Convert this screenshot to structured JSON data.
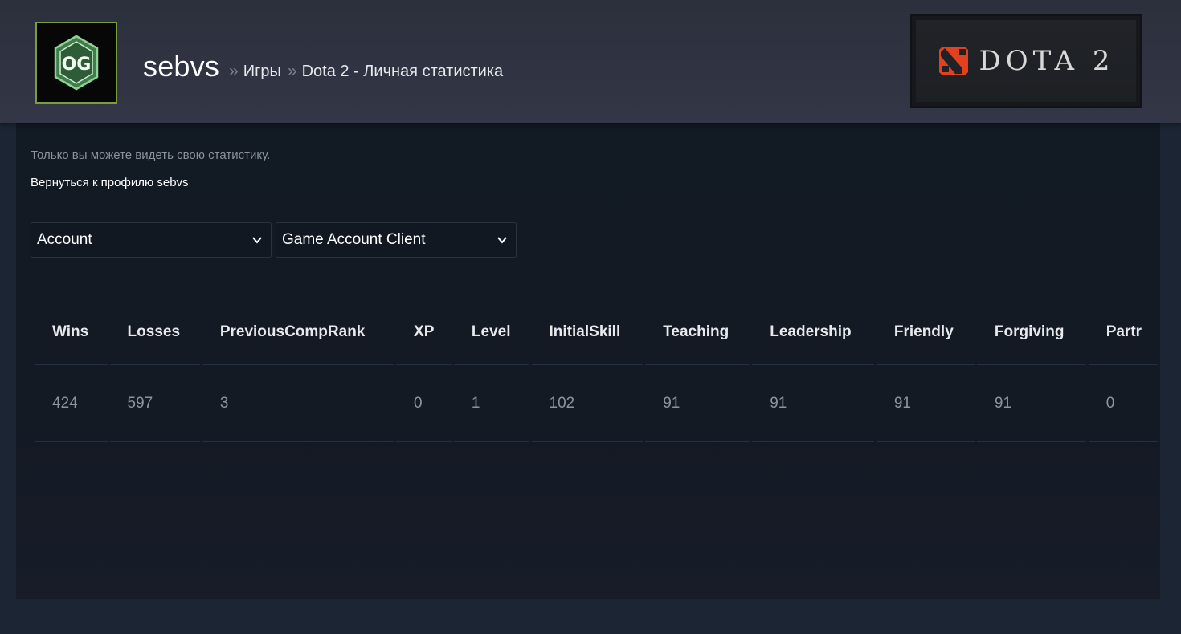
{
  "header": {
    "persona_name": "sebvs",
    "separator": "»",
    "breadcrumbs": [
      "Игры",
      "Dota 2 - Личная статистика"
    ],
    "avatar_icon": "og-team-logo-icon",
    "game_logo": {
      "text": "DOTA 2",
      "icon": "dota2-logo-icon",
      "accent": "#e2401f"
    }
  },
  "main": {
    "privacy_note": "Только вы можете видеть свою статистику.",
    "back_link": "Вернуться к профилю sebvs",
    "filters": [
      {
        "selected": "Account"
      },
      {
        "selected": "Game Account Client"
      }
    ],
    "stats_table": {
      "columns": [
        "Wins",
        "Losses",
        "PreviousCompRank",
        "XP",
        "Level",
        "InitialSkill",
        "Teaching",
        "Leadership",
        "Friendly",
        "Forgiving",
        "Partr"
      ],
      "rows": [
        [
          "424",
          "597",
          "3",
          "0",
          "1",
          "102",
          "91",
          "91",
          "91",
          "91",
          "0"
        ]
      ]
    }
  },
  "colors": {
    "header_bg": "#31343f",
    "page_bg": "#1b2533",
    "content_bg": "#121a24",
    "avatar_border": "#7a9d3e"
  }
}
